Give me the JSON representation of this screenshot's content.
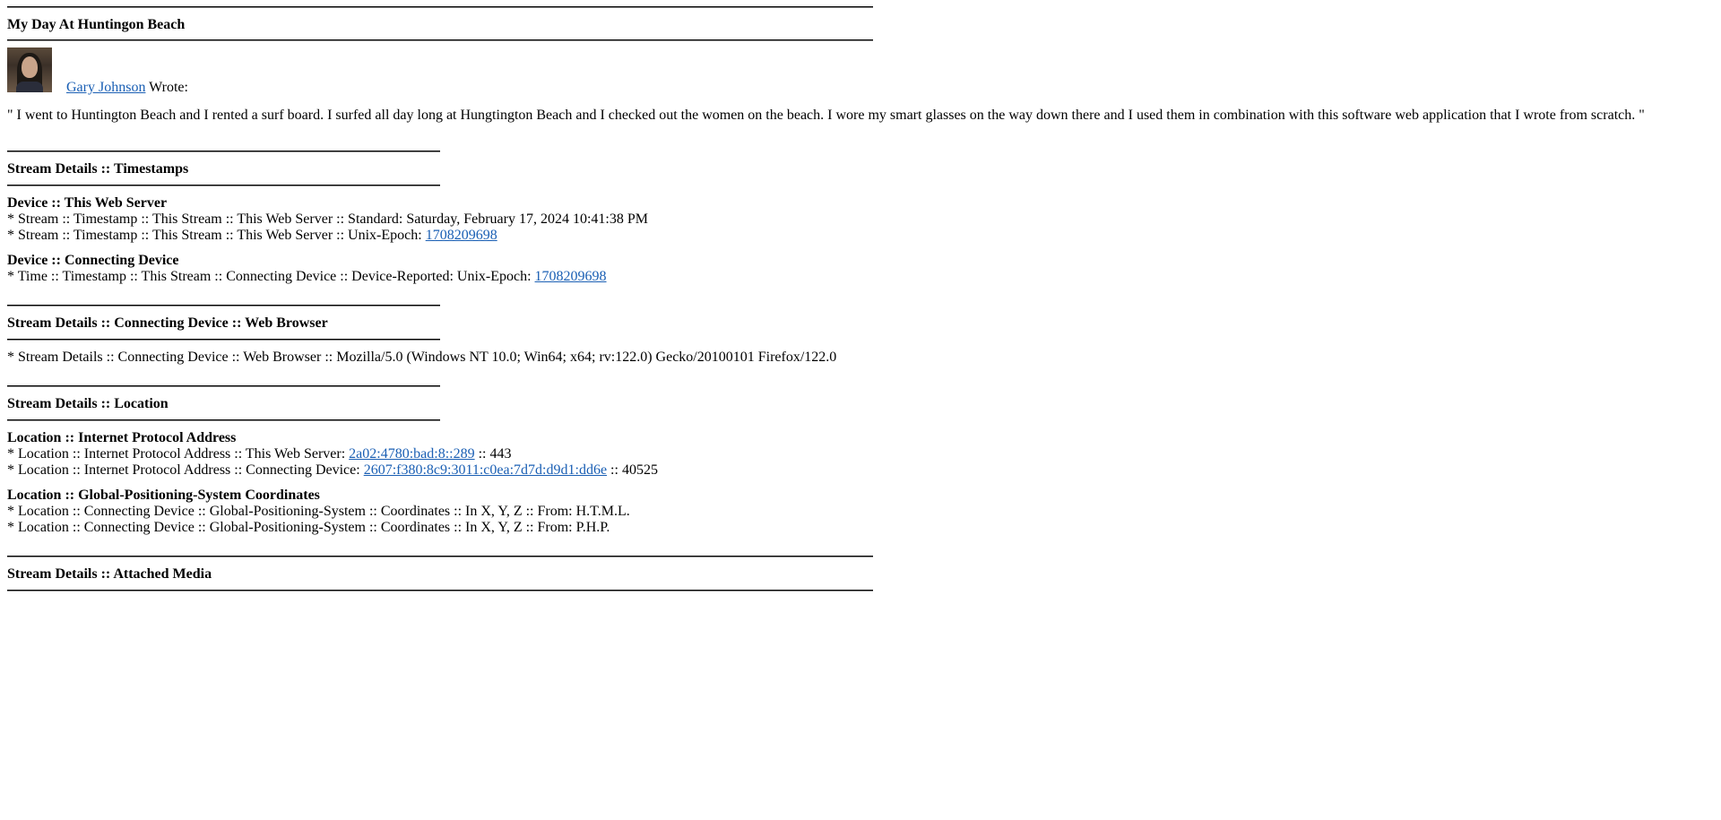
{
  "post": {
    "title": "My Day At Huntingon Beach",
    "author_name": "Gary Johnson",
    "wrote_label": "Wrote:",
    "body": "\" I went to Huntington Beach and I rented a surf board. I surfed all day long at Hungtington Beach and I checked out the women on the beach. I wore my smart glasses on the way down there and I used them in combination with this software web application that I wrote from scratch. \""
  },
  "timestamps": {
    "heading": "Stream Details :: Timestamps",
    "server_heading": "Device :: This Web Server",
    "server_standard": "* Stream :: Timestamp :: This Stream :: This Web Server :: Standard: Saturday, February 17, 2024 10:41:38 PM",
    "server_epoch_label": "* Stream :: Timestamp :: This Stream :: This Web Server :: Unix-Epoch: ",
    "server_epoch_value": "1708209698",
    "device_heading": "Device :: Connecting Device",
    "device_epoch_label": "* Time :: Timestamp :: This Stream :: Connecting Device :: Device-Reported: Unix-Epoch: ",
    "device_epoch_value": "1708209698"
  },
  "browser": {
    "heading": "Stream Details :: Connecting Device :: Web Browser",
    "user_agent": "* Stream Details :: Connecting Device :: Web Browser :: Mozilla/5.0 (Windows NT 10.0; Win64; x64; rv:122.0) Gecko/20100101 Firefox/122.0"
  },
  "location": {
    "heading": "Stream Details :: Location",
    "ip_heading": "Location :: Internet Protocol Address",
    "server_ip_label": "* Location :: Internet Protocol Address :: This Web Server: ",
    "server_ip_value": "2a02:4780:bad:8::289",
    "server_port": " :: 443",
    "device_ip_label": "* Location :: Internet Protocol Address :: Connecting Device: ",
    "device_ip_value": "2607:f380:8c9:3011:c0ea:7d7d:d9d1:dd6e",
    "device_port": " :: 40525",
    "gps_heading": "Location :: Global-Positioning-System Coordinates",
    "gps_html": "* Location :: Connecting Device :: Global-Positioning-System :: Coordinates :: In X, Y, Z :: From: H.T.M.L.",
    "gps_php": "* Location :: Connecting Device :: Global-Positioning-System :: Coordinates :: In X, Y, Z :: From: P.H.P."
  },
  "media": {
    "heading": "Stream Details :: Attached Media"
  }
}
